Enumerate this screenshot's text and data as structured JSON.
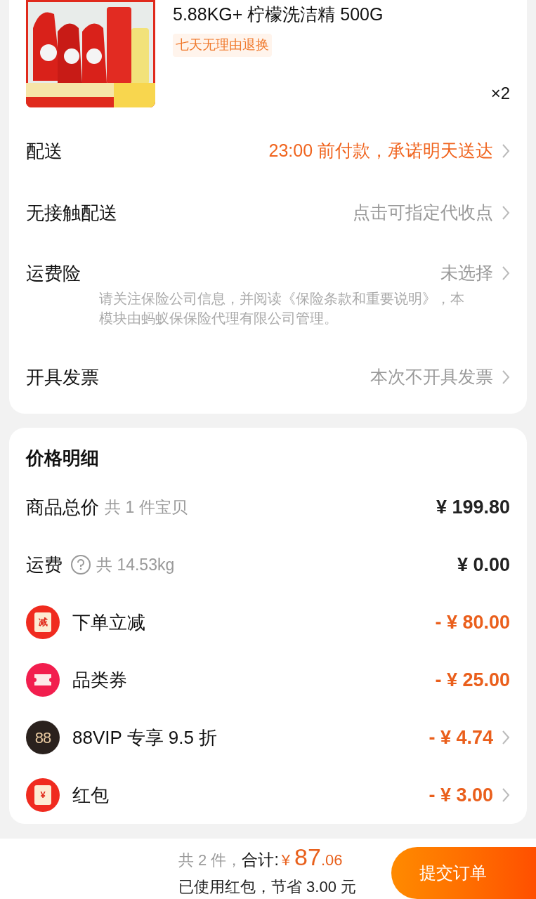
{
  "product": {
    "kind": "picture",
    "title": "5.88KG+ 柠檬洗洁精 500G",
    "badge": "七天无理由退换",
    "quantity": "×2"
  },
  "order_options": [
    {
      "label": "配送",
      "value": "23:00 前付款，承诺明天送达",
      "highlighted": true
    },
    {
      "label": "无接触配送",
      "value": "点击可指定代收点",
      "highlighted": false
    },
    {
      "label": "运费险",
      "value": "未选择",
      "highlighted": false,
      "note": "请关注保险公司信息，并阅读《保险条款和重要说明》，本模块由蚂蚁保保险代理有限公司管理。"
    },
    {
      "label": "开具发票",
      "value": "本次不开具发票",
      "highlighted": false
    }
  ],
  "price_details": {
    "title": "价格明细",
    "rows": [
      {
        "kind": "plain",
        "label": "商品总价",
        "sub": "共 1 件宝贝",
        "amount": "¥ 199.80",
        "chevron": false
      },
      {
        "kind": "help",
        "label": "运费",
        "sub": "共 14.53kg",
        "amount": "¥ 0.00",
        "chevron": false
      },
      {
        "kind": "packet",
        "icon_text": "减",
        "label": "下单立减",
        "amount": "- ¥ 80.00",
        "chevron": false
      },
      {
        "kind": "ticket",
        "label": "品类券",
        "amount": "- ¥ 25.00",
        "chevron": false
      },
      {
        "kind": "vip",
        "icon_text": "88",
        "label": "88VIP 专享 9.5 折",
        "amount": "- ¥ 4.74",
        "chevron": true
      },
      {
        "kind": "packet",
        "icon_text": "¥",
        "label": "红包",
        "amount": "- ¥ 3.00",
        "chevron": true
      }
    ]
  },
  "footer": {
    "count": "共 2 件，",
    "total_label": "合计:",
    "currency": "¥",
    "total_main": "87",
    "total_cents": ".06",
    "savings": "已使用红包，节省 3.00 元",
    "submit": "提交订单"
  }
}
